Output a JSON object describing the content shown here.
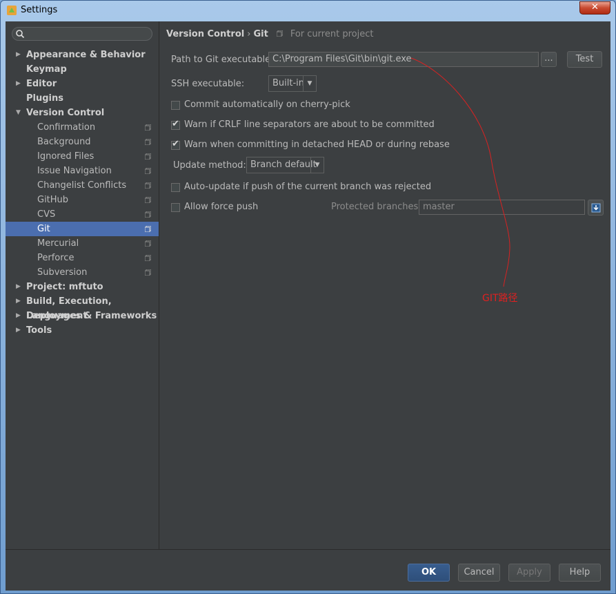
{
  "window": {
    "title": "Settings",
    "close_glyph": "✕"
  },
  "sidebar": {
    "search_placeholder": "",
    "items": [
      {
        "label": "Appearance & Behavior",
        "arrow": "▶"
      },
      {
        "label": "Keymap"
      },
      {
        "label": "Editor",
        "arrow": "▶"
      },
      {
        "label": "Plugins"
      },
      {
        "label": "Version Control",
        "arrow": "▼"
      },
      {
        "label": "Confirmation"
      },
      {
        "label": "Background"
      },
      {
        "label": "Ignored Files"
      },
      {
        "label": "Issue Navigation"
      },
      {
        "label": "Changelist Conflicts"
      },
      {
        "label": "GitHub"
      },
      {
        "label": "CVS"
      },
      {
        "label": "Git"
      },
      {
        "label": "Mercurial"
      },
      {
        "label": "Perforce"
      },
      {
        "label": "Subversion"
      },
      {
        "label": "Project: mftuto",
        "arrow": "▶"
      },
      {
        "label": "Build, Execution, Deployment",
        "arrow": "▶"
      },
      {
        "label": "Languages & Frameworks",
        "arrow": "▶"
      },
      {
        "label": "Tools",
        "arrow": "▶"
      }
    ]
  },
  "main": {
    "breadcrumb": {
      "part1": "Version Control",
      "sep": "›",
      "part2": "Git",
      "project_note": "For current project"
    },
    "path_label": "Path to Git executable:",
    "path_value": "C:\\Program Files\\Git\\bin\\git.exe",
    "browse_label": "...",
    "test_label": "Test",
    "ssh_label": "SSH executable:",
    "ssh_value": "Built-in",
    "cherry_pick_label": "Commit automatically on cherry-pick",
    "crlf_label": "Warn if CRLF line separators are about to be committed",
    "detached_label": "Warn when committing in detached HEAD or during rebase",
    "update_method_label": "Update method:",
    "update_method_value": "Branch default",
    "auto_update_label": "Auto-update if push of the current branch was rejected",
    "force_push_label": "Allow force push",
    "protected_label": "Protected branches:",
    "protected_value": "master",
    "drop_glyph": "▼"
  },
  "footer": {
    "ok": "OK",
    "cancel": "Cancel",
    "apply": "Apply",
    "help": "Help"
  },
  "annotation": {
    "text": "GIT路径",
    "color": "#e02020"
  },
  "colors": {
    "selection": "#4b6eaf",
    "background": "#3c3f41"
  }
}
